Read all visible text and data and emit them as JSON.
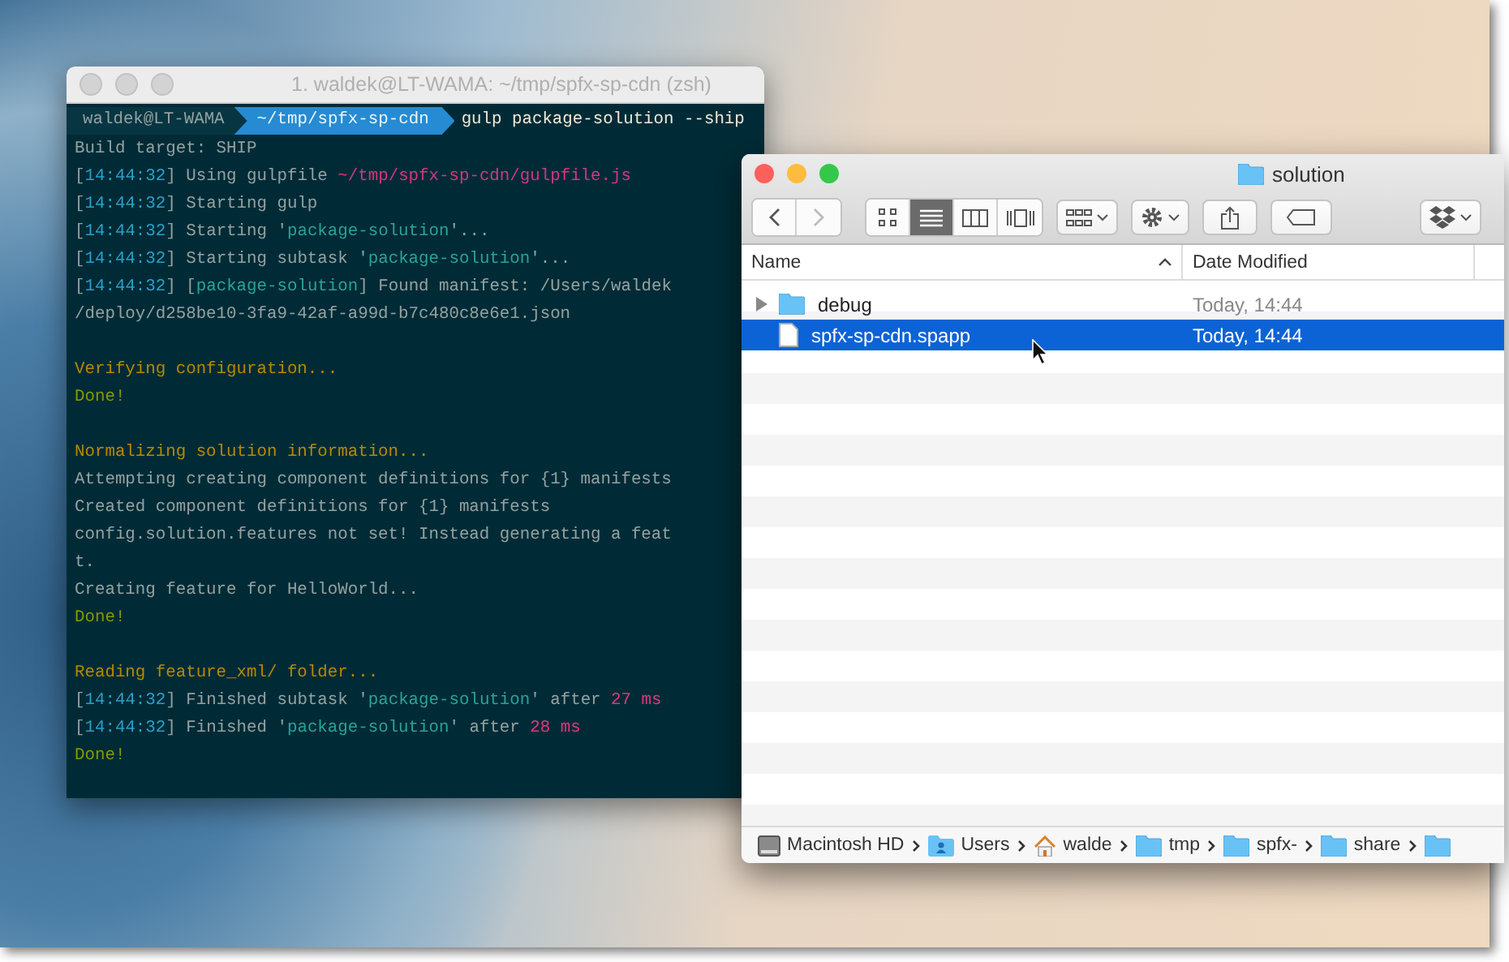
{
  "terminal": {
    "title": "1. waldek@LT-WAMA: ~/tmp/spfx-sp-cdn (zsh)",
    "active": false,
    "prompt": {
      "user": "waldek@LT-WAMA",
      "path": "~/tmp/spfx-sp-cdn",
      "command": "gulp package-solution --ship"
    },
    "lines": [
      {
        "segments": [
          {
            "kind": "plain",
            "text": "Build target: SHIP"
          }
        ]
      },
      {
        "segments": [
          {
            "kind": "plain",
            "text": "["
          },
          {
            "kind": "time",
            "text": "14:44:32"
          },
          {
            "kind": "plain",
            "text": "] Using gulpfile "
          },
          {
            "kind": "path",
            "text": "~/tmp/spfx-sp-cdn/gulpfile.js"
          }
        ]
      },
      {
        "segments": [
          {
            "kind": "plain",
            "text": "["
          },
          {
            "kind": "time",
            "text": "14:44:32"
          },
          {
            "kind": "plain",
            "text": "] Starting gulp"
          }
        ]
      },
      {
        "segments": [
          {
            "kind": "plain",
            "text": "["
          },
          {
            "kind": "time",
            "text": "14:44:32"
          },
          {
            "kind": "plain",
            "text": "] Starting '"
          },
          {
            "kind": "task",
            "text": "package-solution"
          },
          {
            "kind": "plain",
            "text": "'..."
          }
        ]
      },
      {
        "segments": [
          {
            "kind": "plain",
            "text": "["
          },
          {
            "kind": "time",
            "text": "14:44:32"
          },
          {
            "kind": "plain",
            "text": "] Starting subtask '"
          },
          {
            "kind": "task",
            "text": "package-solution"
          },
          {
            "kind": "plain",
            "text": "'..."
          }
        ]
      },
      {
        "segments": [
          {
            "kind": "plain",
            "text": "["
          },
          {
            "kind": "time",
            "text": "14:44:32"
          },
          {
            "kind": "plain",
            "text": "] ["
          },
          {
            "kind": "task",
            "text": "package-solution"
          },
          {
            "kind": "plain",
            "text": "] Found manifest: /Users/waldek"
          }
        ]
      },
      {
        "segments": [
          {
            "kind": "plain",
            "text": "/deploy/d258be10-3fa9-42af-a99d-b7c480c8e6e1.json"
          }
        ]
      },
      {
        "kind": "blank"
      },
      {
        "segments": [
          {
            "kind": "heading",
            "text": "Verifying configuration..."
          }
        ]
      },
      {
        "segments": [
          {
            "kind": "done",
            "text": "Done!"
          }
        ]
      },
      {
        "kind": "blank"
      },
      {
        "segments": [
          {
            "kind": "heading",
            "text": "Normalizing solution information..."
          }
        ]
      },
      {
        "segments": [
          {
            "kind": "plain",
            "text": "Attempting creating component definitions for {1} manifests"
          }
        ]
      },
      {
        "segments": [
          {
            "kind": "plain",
            "text": "Created component definitions for {1} manifests"
          }
        ]
      },
      {
        "segments": [
          {
            "kind": "plain",
            "text": "config.solution.features not set! Instead generating a feat"
          }
        ]
      },
      {
        "segments": [
          {
            "kind": "plain",
            "text": "t."
          }
        ]
      },
      {
        "segments": [
          {
            "kind": "plain",
            "text": "Creating feature for HelloWorld..."
          }
        ]
      },
      {
        "segments": [
          {
            "kind": "done",
            "text": "Done!"
          }
        ]
      },
      {
        "kind": "blank"
      },
      {
        "segments": [
          {
            "kind": "heading",
            "text": "Reading feature_xml/ folder..."
          }
        ]
      },
      {
        "segments": [
          {
            "kind": "plain",
            "text": "["
          },
          {
            "kind": "time",
            "text": "14:44:32"
          },
          {
            "kind": "plain",
            "text": "] Finished subtask '"
          },
          {
            "kind": "task",
            "text": "package-solution"
          },
          {
            "kind": "plain",
            "text": "' after "
          },
          {
            "kind": "number",
            "text": "27 ms"
          }
        ]
      },
      {
        "segments": [
          {
            "kind": "plain",
            "text": "["
          },
          {
            "kind": "time",
            "text": "14:44:32"
          },
          {
            "kind": "plain",
            "text": "] Finished '"
          },
          {
            "kind": "task",
            "text": "package-solution"
          },
          {
            "kind": "plain",
            "text": "' after "
          },
          {
            "kind": "number",
            "text": "28 ms"
          }
        ]
      },
      {
        "segments": [
          {
            "kind": "done",
            "text": "Done!"
          }
        ]
      }
    ]
  },
  "finder": {
    "title": "solution",
    "active": true,
    "view_modes": [
      {
        "kind": "icons",
        "selected": false
      },
      {
        "kind": "list",
        "selected": true
      },
      {
        "kind": "columns",
        "selected": false
      },
      {
        "kind": "coverflow",
        "selected": false
      }
    ],
    "columns": [
      {
        "label": "Name",
        "sorted": true
      },
      {
        "label": "Date Modified",
        "sorted": false
      }
    ],
    "rows": [
      {
        "kind": "folder",
        "name": "debug",
        "date": "Today, 14:44",
        "selected": false
      },
      {
        "kind": "file",
        "name": "spfx-sp-cdn.spapp",
        "date": "Today, 14:44",
        "selected": true
      }
    ],
    "path_bar": [
      {
        "kind": "disk",
        "label": "Macintosh HD"
      },
      {
        "kind": "users",
        "label": "Users"
      },
      {
        "kind": "home",
        "label": "walde"
      },
      {
        "kind": "folder",
        "label": "tmp"
      },
      {
        "kind": "folder",
        "label": "spfx-"
      },
      {
        "kind": "folder",
        "label": "share"
      }
    ]
  }
}
